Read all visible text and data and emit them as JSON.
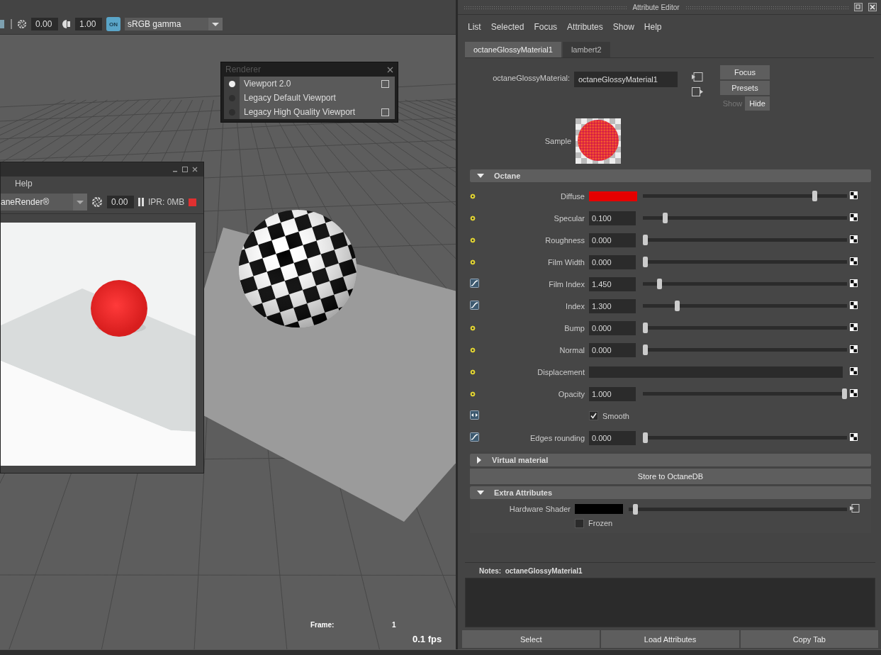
{
  "viewport": {
    "toolbar": {
      "exposure": "0.00",
      "gamma": "1.00",
      "color_management": "ON",
      "color_space": "sRGB gamma"
    },
    "renderer_menu": {
      "title": "Renderer",
      "items": [
        {
          "label": "Viewport 2.0",
          "selected": true,
          "has_options": true
        },
        {
          "label": "Legacy Default Viewport",
          "selected": false,
          "has_options": false
        },
        {
          "label": "Legacy High Quality Viewport",
          "selected": false,
          "has_options": true
        }
      ]
    },
    "render_window": {
      "menu": [
        "Help"
      ],
      "renderer": "aneRender®",
      "value": "0.00",
      "memory": "IPR: 0MB"
    },
    "frame_label": "Frame:",
    "frame": "1",
    "fps": "0.1 fps"
  },
  "attribute_editor": {
    "title": "Attribute Editor",
    "menu": [
      "List",
      "Selected",
      "Focus",
      "Attributes",
      "Show",
      "Help"
    ],
    "tabs": [
      {
        "label": "octaneGlossyMaterial1",
        "selected": true
      },
      {
        "label": "lambert2",
        "selected": false
      }
    ],
    "node_label": "octaneGlossyMaterial:",
    "node_name": "octaneGlossyMaterial1",
    "side_buttons": [
      "Focus",
      "Presets"
    ],
    "visibility_buttons": [
      {
        "label": "Show",
        "disabled": true
      },
      {
        "label": "Hide",
        "disabled": false
      }
    ],
    "sample_label": "Sample",
    "blocks": [
      {
        "kind": "section",
        "title": "Octane",
        "expanded": true,
        "rows": [
          {
            "kind": "color",
            "label": "Diffuse",
            "color": "#e60000",
            "level": 0.85
          },
          {
            "kind": "slider",
            "label": "Specular",
            "value": "0.100",
            "level": 0.1
          },
          {
            "kind": "slider",
            "label": "Roughness",
            "value": "0.000",
            "level": 0
          },
          {
            "kind": "slider",
            "label": "Film Width",
            "value": "0.000",
            "level": 0
          },
          {
            "kind": "slider",
            "label": "Film Index",
            "value": "1.450",
            "level": 0.07
          },
          {
            "kind": "slider",
            "label": "Index",
            "value": "1.300",
            "level": 0.16
          },
          {
            "kind": "slider",
            "label": "Bump",
            "value": "0.000",
            "level": 0
          },
          {
            "kind": "slider",
            "label": "Normal",
            "value": "0.000",
            "level": 0
          },
          {
            "kind": "map",
            "label": "Displacement"
          },
          {
            "kind": "slider",
            "label": "Opacity",
            "value": "1.000",
            "level": 1
          },
          {
            "kind": "checkbox",
            "label": "Smooth",
            "checked": true
          },
          {
            "kind": "slider",
            "label": "Edges rounding",
            "value": "0.000",
            "level": 0
          }
        ]
      },
      {
        "kind": "section",
        "title": "Virtual material",
        "expanded": false
      },
      {
        "kind": "button",
        "label": "Store to OctaneDB"
      },
      {
        "kind": "section",
        "title": "Extra Attributes",
        "expanded": true,
        "rows": [
          {
            "kind": "color",
            "label": "Hardware Shader",
            "color": "#000000",
            "level": 0.02
          },
          {
            "kind": "checkbox",
            "label": "Frozen",
            "checked": false
          }
        ]
      }
    ],
    "notes_label": "Notes:",
    "notes_node": "octaneGlossyMaterial1",
    "bottom_buttons": [
      "Select",
      "Load Attributes",
      "Copy Tab"
    ]
  }
}
